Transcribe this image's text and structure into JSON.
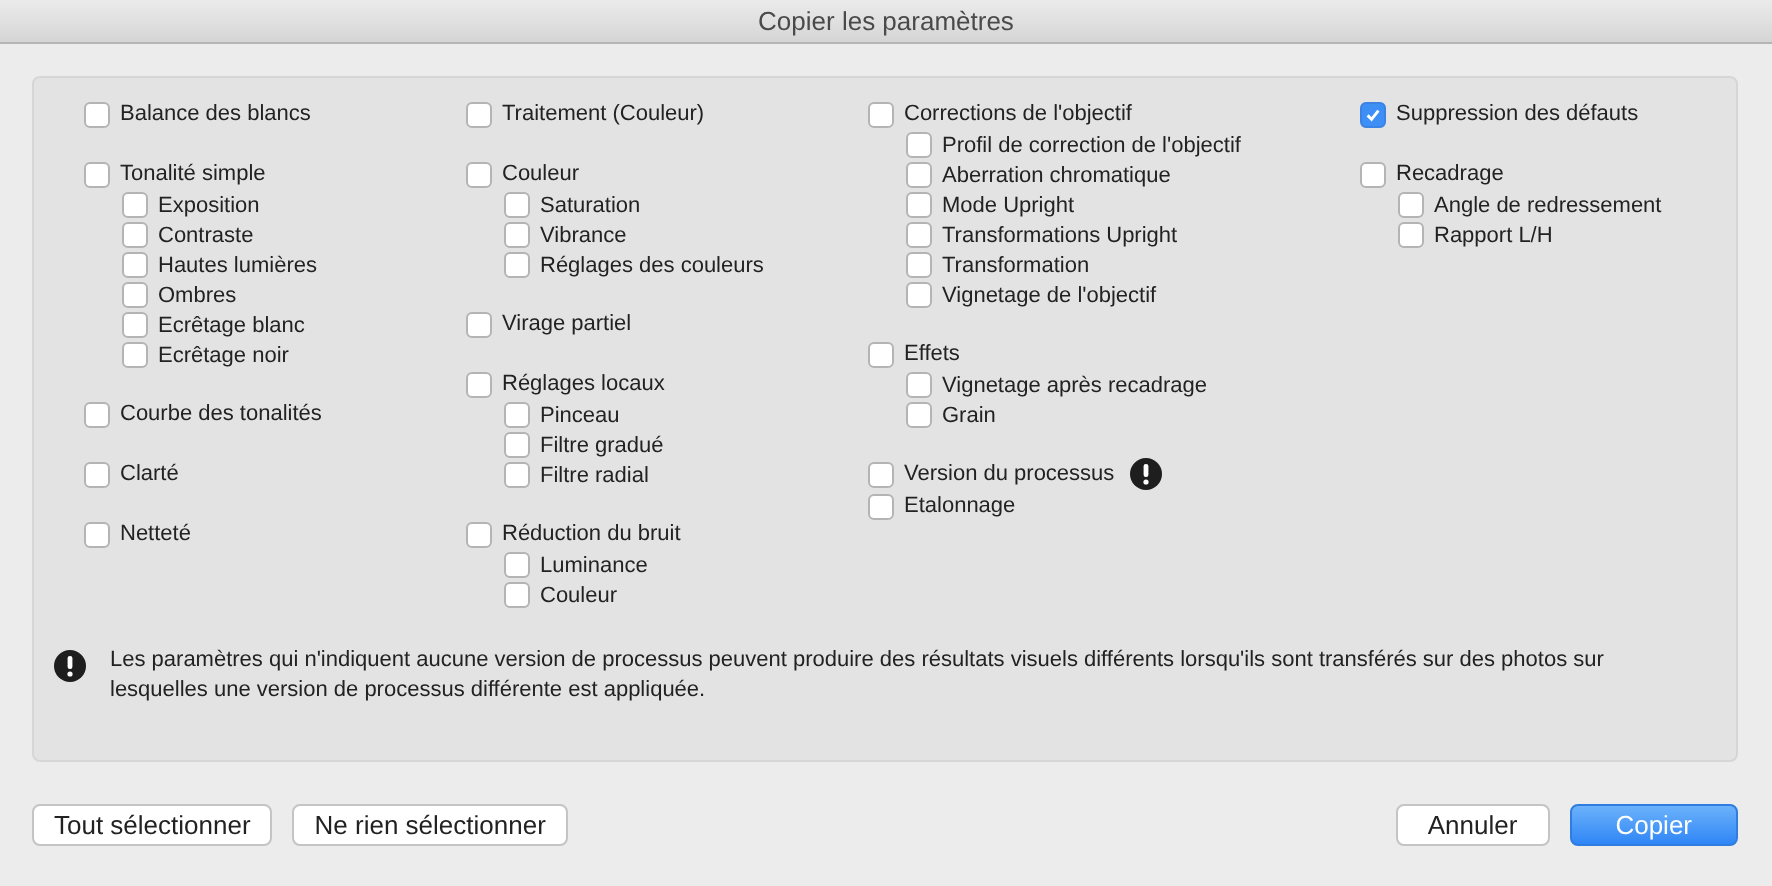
{
  "window": {
    "title": "Copier les paramètres"
  },
  "columns": [
    [
      {
        "items": [
          {
            "label": "Balance des blancs",
            "checked": false
          }
        ]
      },
      {
        "items": [
          {
            "label": "Tonalité simple",
            "checked": false,
            "children": [
              {
                "label": "Exposition",
                "checked": false
              },
              {
                "label": "Contraste",
                "checked": false
              },
              {
                "label": "Hautes lumières",
                "checked": false
              },
              {
                "label": "Ombres",
                "checked": false
              },
              {
                "label": "Ecrêtage blanc",
                "checked": false
              },
              {
                "label": "Ecrêtage noir",
                "checked": false
              }
            ]
          }
        ]
      },
      {
        "items": [
          {
            "label": "Courbe des tonalités",
            "checked": false
          }
        ]
      },
      {
        "items": [
          {
            "label": "Clarté",
            "checked": false
          }
        ]
      },
      {
        "items": [
          {
            "label": "Netteté",
            "checked": false
          }
        ]
      }
    ],
    [
      {
        "items": [
          {
            "label": "Traitement (Couleur)",
            "checked": false
          }
        ]
      },
      {
        "items": [
          {
            "label": "Couleur",
            "checked": false,
            "children": [
              {
                "label": "Saturation",
                "checked": false
              },
              {
                "label": "Vibrance",
                "checked": false
              },
              {
                "label": "Réglages des couleurs",
                "checked": false
              }
            ]
          }
        ]
      },
      {
        "items": [
          {
            "label": "Virage partiel",
            "checked": false
          }
        ]
      },
      {
        "items": [
          {
            "label": "Réglages locaux",
            "checked": false,
            "children": [
              {
                "label": "Pinceau",
                "checked": false
              },
              {
                "label": "Filtre gradué",
                "checked": false
              },
              {
                "label": "Filtre radial",
                "checked": false
              }
            ]
          }
        ]
      },
      {
        "items": [
          {
            "label": "Réduction du bruit",
            "checked": false,
            "children": [
              {
                "label": "Luminance",
                "checked": false
              },
              {
                "label": "Couleur",
                "checked": false
              }
            ]
          }
        ]
      }
    ],
    [
      {
        "items": [
          {
            "label": "Corrections de l'objectif",
            "checked": false,
            "children": [
              {
                "label": "Profil de correction de l'objectif",
                "checked": false
              },
              {
                "label": "Aberration chromatique",
                "checked": false
              },
              {
                "label": "Mode Upright",
                "checked": false
              },
              {
                "label": "Transformations Upright",
                "checked": false
              },
              {
                "label": "Transformation",
                "checked": false
              },
              {
                "label": "Vignetage de l'objectif",
                "checked": false
              }
            ]
          }
        ]
      },
      {
        "items": [
          {
            "label": "Effets",
            "checked": false,
            "children": [
              {
                "label": "Vignetage après recadrage",
                "checked": false
              },
              {
                "label": "Grain",
                "checked": false
              }
            ]
          }
        ]
      },
      {
        "items": [
          {
            "label": "Version du processus",
            "checked": false,
            "warning": true
          },
          {
            "label": "Etalonnage",
            "checked": false
          }
        ]
      }
    ],
    [
      {
        "items": [
          {
            "label": "Suppression des défauts",
            "checked": true
          }
        ]
      },
      {
        "items": [
          {
            "label": "Recadrage",
            "checked": false,
            "children": [
              {
                "label": "Angle de redressement",
                "checked": false
              },
              {
                "label": "Rapport L/H",
                "checked": false
              }
            ]
          }
        ]
      }
    ]
  ],
  "note": "Les paramètres qui n'indiquent aucune version de processus peuvent produire des résultats visuels différents lorsqu'ils sont transférés sur des photos sur lesquelles une version de processus différente est appliquée.",
  "buttons": [
    {
      "label": "Tout sélectionner",
      "kind": "left"
    },
    {
      "label": "Ne rien sélectionner",
      "kind": "left"
    },
    {
      "label": "Annuler",
      "kind": "right"
    },
    {
      "label": "Copier",
      "kind": "default"
    }
  ]
}
